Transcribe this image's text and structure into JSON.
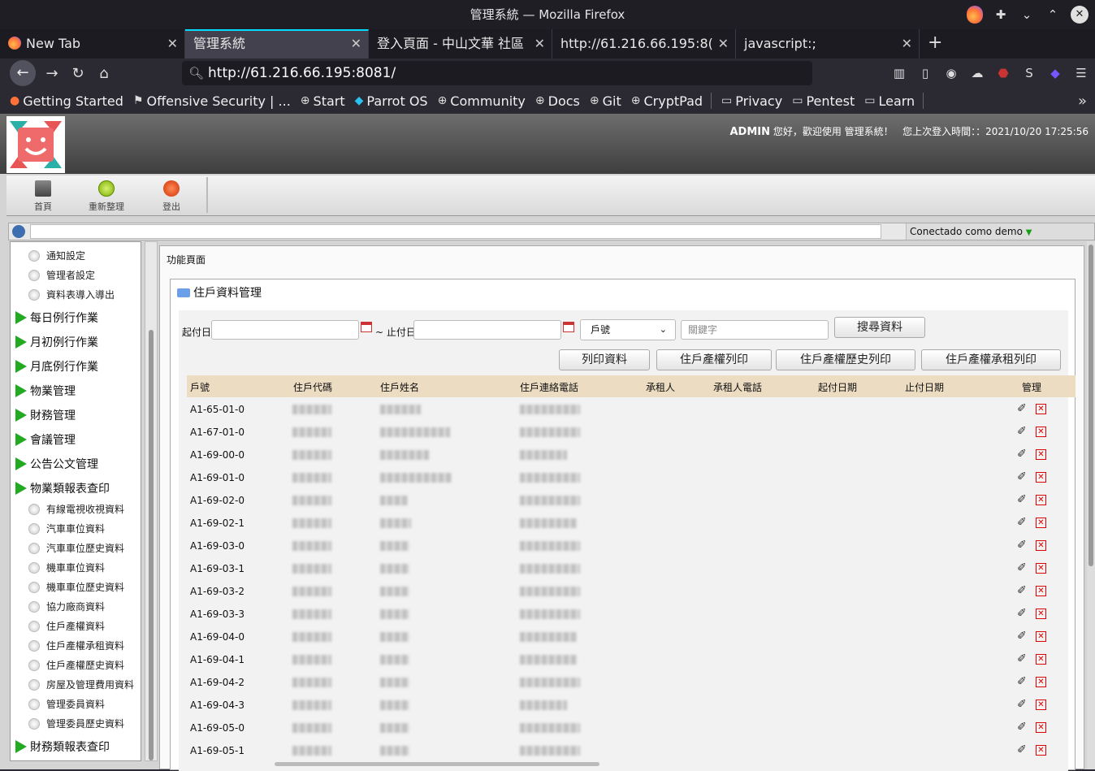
{
  "window": {
    "title": "管理系統 — Mozilla Firefox"
  },
  "tabs": [
    {
      "label": "New Tab"
    },
    {
      "label": "管理系統"
    },
    {
      "label": "登入頁面 - 中山文華 社區"
    },
    {
      "label": "http://61.216.66.195:8("
    },
    {
      "label": "javascript:;"
    }
  ],
  "url": "http://61.216.66.195:8081/",
  "bookmarks": [
    "Getting Started",
    "Offensive Security | ...",
    "Start",
    "Parrot OS",
    "Community",
    "Docs",
    "Git",
    "CryptPad",
    "Privacy",
    "Pentest",
    "Learn"
  ],
  "header": {
    "admin": "ADMIN",
    "welcome": "您好，歡迎使用 管理系統！",
    "last_login": "您上次登入時間：：2021/10/20 17:25:56"
  },
  "toolbar": {
    "home": "首頁",
    "refresh": "重新整理",
    "logout": "登出"
  },
  "status": {
    "user": "Conectado como demo"
  },
  "sidebar": {
    "items": [
      {
        "label": "通知設定",
        "type": "sub"
      },
      {
        "label": "管理者設定",
        "type": "sub"
      },
      {
        "label": "資料表導入導出",
        "type": "sub"
      },
      {
        "label": "每日例行作業",
        "type": "main"
      },
      {
        "label": "月初例行作業",
        "type": "main"
      },
      {
        "label": "月底例行作業",
        "type": "main"
      },
      {
        "label": "物業管理",
        "type": "main"
      },
      {
        "label": "財務管理",
        "type": "main"
      },
      {
        "label": "會議管理",
        "type": "main"
      },
      {
        "label": "公告公文管理",
        "type": "main"
      },
      {
        "label": "物業類報表查印",
        "type": "main"
      },
      {
        "label": "有線電視收視資料",
        "type": "sub"
      },
      {
        "label": "汽車車位資料",
        "type": "sub"
      },
      {
        "label": "汽車車位歷史資料",
        "type": "sub"
      },
      {
        "label": "機車車位資料",
        "type": "sub"
      },
      {
        "label": "機車車位歷史資料",
        "type": "sub"
      },
      {
        "label": "協力廠商資料",
        "type": "sub"
      },
      {
        "label": "住戶產權資料",
        "type": "sub"
      },
      {
        "label": "住戶產權承租資料",
        "type": "sub"
      },
      {
        "label": "住戶產權歷史資料",
        "type": "sub"
      },
      {
        "label": "房屋及管理費用資料",
        "type": "sub"
      },
      {
        "label": "管理委員資料",
        "type": "sub"
      },
      {
        "label": "管理委員歷史資料",
        "type": "sub"
      },
      {
        "label": "財務類報表查印",
        "type": "main"
      }
    ]
  },
  "panel": {
    "title": "功能頁面",
    "section": "住戶資料管理"
  },
  "form": {
    "start_label": "起付日",
    "sep_label": "~ 止付日",
    "field_select": "戶號",
    "keyword_placeholder": "關鍵字",
    "search_btn": "搜尋資料",
    "print_btn": "列印資料",
    "prop_print_btn": "住戶產權列印",
    "hist_print_btn": "住戶產權歷史列印",
    "rent_print_btn": "住戶產權承租列印"
  },
  "table": {
    "columns": [
      "戶號",
      "住戶代碼",
      "住戶姓名",
      "住戶連絡電話",
      "承租人",
      "承租人電話",
      "起付日期",
      "止付日期",
      "管理"
    ],
    "rows": [
      "A1-65-01-0",
      "A1-67-01-0",
      "A1-69-00-0",
      "A1-69-01-0",
      "A1-69-02-0",
      "A1-69-02-1",
      "A1-69-03-0",
      "A1-69-03-1",
      "A1-69-03-2",
      "A1-69-03-3",
      "A1-69-04-0",
      "A1-69-04-1",
      "A1-69-04-2",
      "A1-69-04-3",
      "A1-69-05-0",
      "A1-69-05-1"
    ]
  }
}
